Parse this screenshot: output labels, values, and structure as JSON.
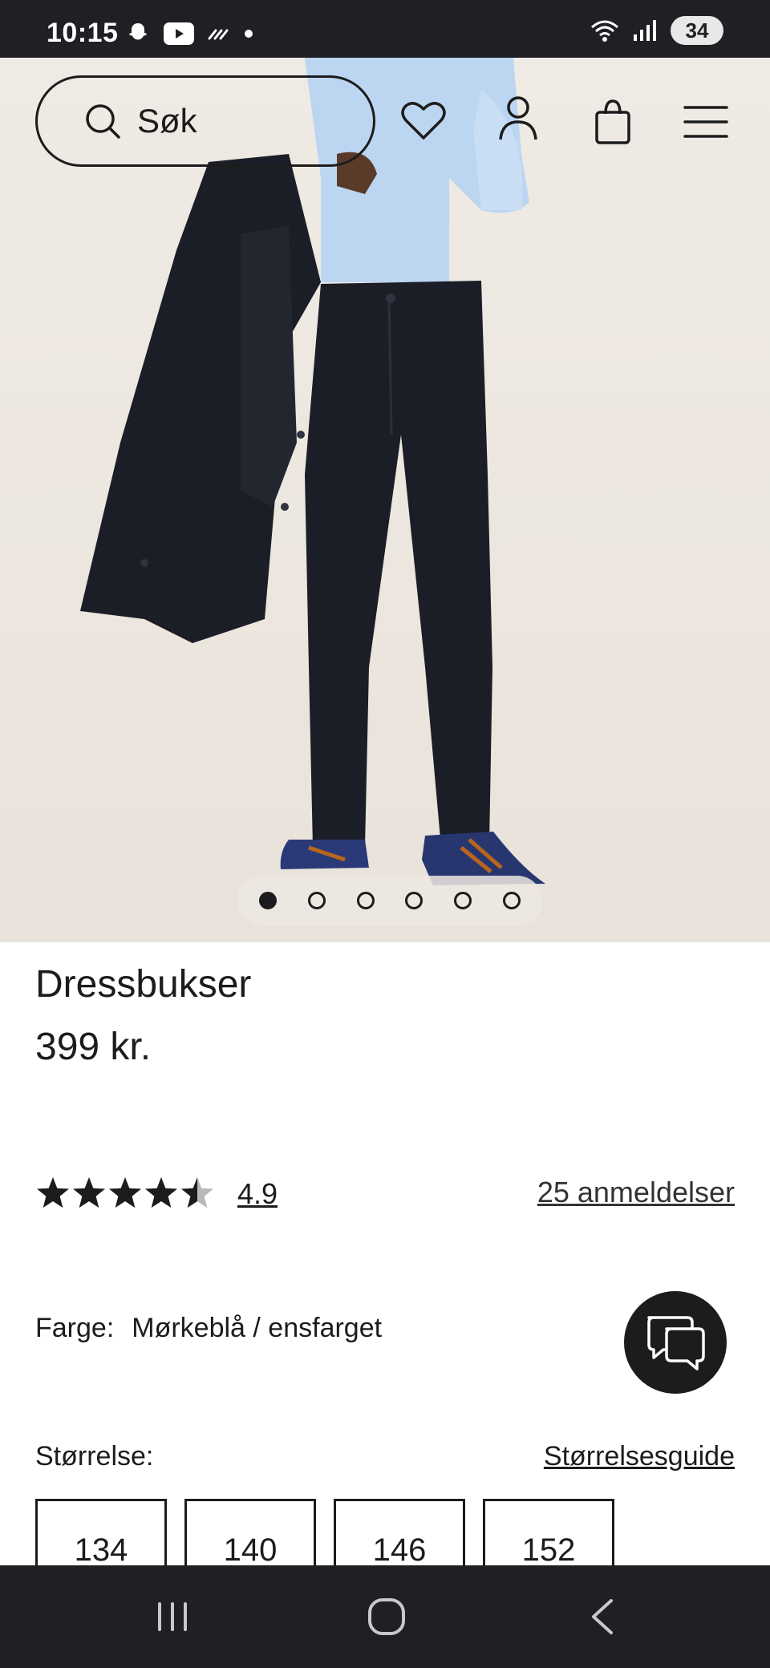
{
  "status_bar": {
    "time": "10:15",
    "battery": "34",
    "icons": [
      "snapchat-icon",
      "youtube-icon",
      "missed-call-icon",
      "dot-icon",
      "wifi-icon",
      "signal-icon"
    ]
  },
  "header": {
    "search_label": "Søk",
    "icons": [
      "search-icon",
      "heart-icon",
      "user-icon",
      "bag-icon",
      "menu-icon"
    ]
  },
  "carousel": {
    "total": 6,
    "active_index": 0
  },
  "product": {
    "name": "Dressbukser",
    "price": "399 kr."
  },
  "rating": {
    "value": "4.9",
    "stars_filled": 4.5,
    "stars_total": 5,
    "reviews_label": "25 anmeldelser"
  },
  "color": {
    "label": "Farge:",
    "value": "Mørkeblå / ensfarget"
  },
  "size": {
    "label": "Størrelse:",
    "guide_label": "Størrelsesguide",
    "options": [
      "134",
      "140",
      "146",
      "152"
    ]
  },
  "colors": {
    "ink": "#1c1c1c",
    "system_bar": "#1f1f24",
    "background": "#ffffff"
  }
}
